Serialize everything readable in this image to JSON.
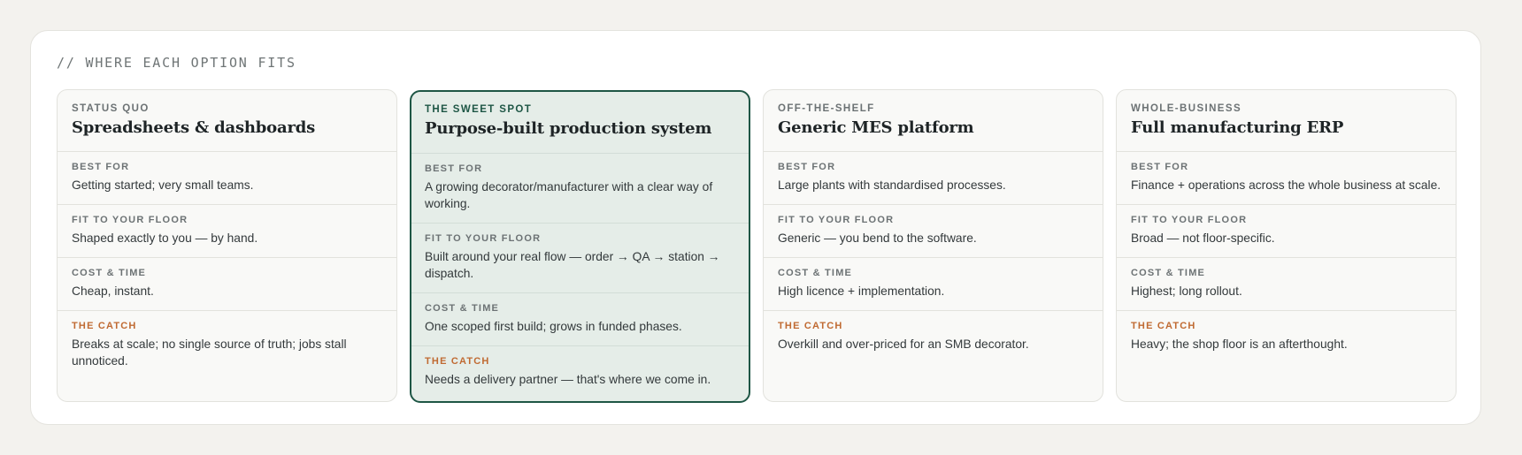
{
  "section_title": "// WHERE EACH OPTION FITS",
  "options": [
    {
      "eyebrow": "STATUS QUO",
      "title": "Spreadsheets & dashboards",
      "rows": [
        {
          "label": "BEST FOR",
          "text": "Getting started; very small teams."
        },
        {
          "label": "FIT TO YOUR FLOOR",
          "text": "Shaped exactly to you — by hand."
        },
        {
          "label": "COST & TIME",
          "text": "Cheap, instant."
        },
        {
          "label": "THE CATCH",
          "text": "Breaks at scale; no single source of truth; jobs stall unnoticed."
        }
      ]
    },
    {
      "eyebrow": "THE SWEET SPOT",
      "title": "Purpose-built production system",
      "rows": [
        {
          "label": "BEST FOR",
          "text": "A growing decorator/manufacturer with a clear way of working."
        },
        {
          "label": "FIT TO YOUR FLOOR",
          "text": "Built around your real flow — order → QA → station → dispatch."
        },
        {
          "label": "COST & TIME",
          "text": "One scoped first build; grows in funded phases."
        },
        {
          "label": "THE CATCH",
          "text": "Needs a delivery partner — that's where we come in."
        }
      ]
    },
    {
      "eyebrow": "OFF-THE-SHELF",
      "title": "Generic MES platform",
      "rows": [
        {
          "label": "BEST FOR",
          "text": "Large plants with standardised processes."
        },
        {
          "label": "FIT TO YOUR FLOOR",
          "text": "Generic — you bend to the software."
        },
        {
          "label": "COST & TIME",
          "text": "High licence + implementation."
        },
        {
          "label": "THE CATCH",
          "text": "Overkill and over-priced for an SMB decorator."
        }
      ]
    },
    {
      "eyebrow": "WHOLE-BUSINESS",
      "title": "Full manufacturing ERP",
      "rows": [
        {
          "label": "BEST FOR",
          "text": "Finance + operations across the whole business at scale."
        },
        {
          "label": "FIT TO YOUR FLOOR",
          "text": "Broad — not floor-specific."
        },
        {
          "label": "COST & TIME",
          "text": "Highest; long rollout."
        },
        {
          "label": "THE CATCH",
          "text": "Heavy; the shop floor is an afterthought."
        }
      ]
    }
  ],
  "colors": {
    "accent_green": "#1e5645",
    "featured_bg": "#e5ede8",
    "catch_orange": "#c06a32"
  }
}
